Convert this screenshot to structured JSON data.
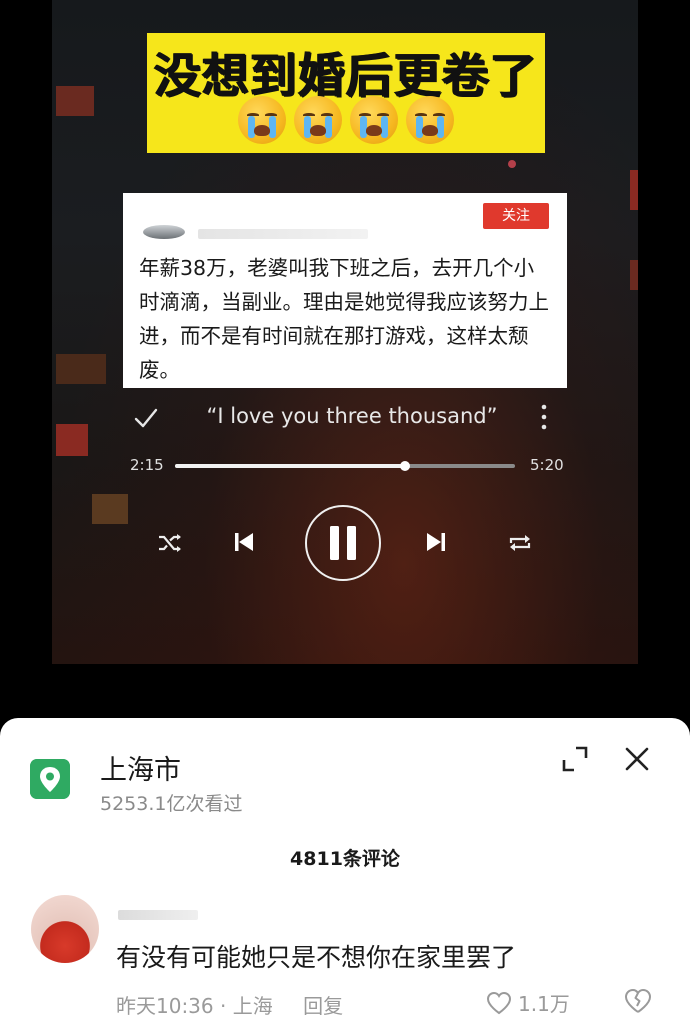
{
  "video": {
    "caption": "没想到婚后更卷了",
    "caption_emojis": [
      "loudly-crying-face",
      "loudly-crying-face",
      "loudly-crying-face",
      "loudly-crying-face"
    ],
    "post_card": {
      "follow_label": "关注",
      "text": "年薪38万，老婆叫我下班之后，去开几个小时滴滴，当副业。理由是她觉得我应该努力上进，而不是有时间就在那打游戏，这样太颓废。"
    },
    "player": {
      "song_title": "“I love you three thousand”",
      "current_time": "2:15",
      "total_time": "5:20",
      "progress": 0.675
    }
  },
  "sheet": {
    "location": "上海市",
    "views": "5253.1亿次看过",
    "comment_count": "4811条评论",
    "comment": {
      "text": "有没有可能她只是不想你在家里罢了",
      "time": "昨天10:36",
      "location": "上海",
      "reply_label": "回复",
      "likes": "1.1万"
    }
  },
  "colors": {
    "caption_bg": "#f6e61b",
    "follow_bg": "#e0392d",
    "location_pin": "#2faa62"
  }
}
